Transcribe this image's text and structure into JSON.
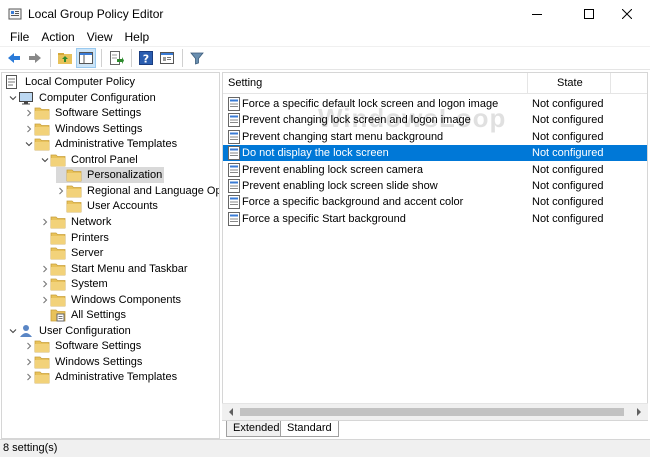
{
  "window": {
    "title": "Local Group Policy Editor",
    "minimize_icon": "minimize-icon",
    "maximize_icon": "maximize-icon",
    "close_icon": "close-icon"
  },
  "menu": [
    "File",
    "Action",
    "View",
    "Help"
  ],
  "toolbar": {
    "icons": [
      "back-arrow-icon",
      "forward-arrow-icon",
      "up-folder-icon",
      "show-hide-tree-icon",
      "export-list-icon",
      "help-icon",
      "properties-icon",
      "filter-icon"
    ]
  },
  "tree": [
    {
      "label": "Local Computer Policy",
      "level": 0,
      "arrow": "",
      "icon": "policy-icon"
    },
    {
      "label": "Computer Configuration",
      "level": 1,
      "arrow": "expanded",
      "icon": "computer-icon"
    },
    {
      "label": "Software Settings",
      "level": 2,
      "arrow": "collapsed",
      "icon": "folder-icon"
    },
    {
      "label": "Windows Settings",
      "level": 2,
      "arrow": "collapsed",
      "icon": "folder-icon"
    },
    {
      "label": "Administrative Templates",
      "level": 2,
      "arrow": "expanded",
      "icon": "folder-icon"
    },
    {
      "label": "Control Panel",
      "level": 3,
      "arrow": "expanded",
      "icon": "folder-icon"
    },
    {
      "label": "Personalization",
      "level": 4,
      "arrow": "",
      "icon": "folder-icon",
      "selected": true
    },
    {
      "label": "Regional and Language Opt",
      "level": 4,
      "arrow": "collapsed",
      "icon": "folder-icon"
    },
    {
      "label": "User Accounts",
      "level": 4,
      "arrow": "",
      "icon": "folder-icon"
    },
    {
      "label": "Network",
      "level": 3,
      "arrow": "collapsed",
      "icon": "folder-icon"
    },
    {
      "label": "Printers",
      "level": 3,
      "arrow": "",
      "icon": "folder-icon"
    },
    {
      "label": "Server",
      "level": 3,
      "arrow": "",
      "icon": "folder-icon"
    },
    {
      "label": "Start Menu and Taskbar",
      "level": 3,
      "arrow": "collapsed",
      "icon": "folder-icon"
    },
    {
      "label": "System",
      "level": 3,
      "arrow": "collapsed",
      "icon": "folder-icon"
    },
    {
      "label": "Windows Components",
      "level": 3,
      "arrow": "collapsed",
      "icon": "folder-icon"
    },
    {
      "label": "All Settings",
      "level": 3,
      "arrow": "",
      "icon": "all-settings-icon"
    },
    {
      "label": "User Configuration",
      "level": 1,
      "arrow": "expanded",
      "icon": "user-icon"
    },
    {
      "label": "Software Settings",
      "level": 2,
      "arrow": "collapsed",
      "icon": "folder-icon"
    },
    {
      "label": "Windows Settings",
      "level": 2,
      "arrow": "collapsed",
      "icon": "folder-icon"
    },
    {
      "label": "Administrative Templates",
      "level": 2,
      "arrow": "collapsed",
      "icon": "folder-icon"
    }
  ],
  "list": {
    "columns": {
      "setting": "Setting",
      "state": "State"
    },
    "rows": [
      {
        "setting": "Force a specific default lock screen and logon image",
        "state": "Not configured"
      },
      {
        "setting": "Prevent changing lock screen and logon image",
        "state": "Not configured"
      },
      {
        "setting": "Prevent changing start menu background",
        "state": "Not configured"
      },
      {
        "setting": "Do not display the lock screen",
        "state": "Not configured",
        "selected": true
      },
      {
        "setting": "Prevent enabling lock screen camera",
        "state": "Not configured"
      },
      {
        "setting": "Prevent enabling lock screen slide show",
        "state": "Not configured"
      },
      {
        "setting": "Force a specific background and accent color",
        "state": "Not configured"
      },
      {
        "setting": "Force a specific Start background",
        "state": "Not configured"
      }
    ],
    "watermark": "WindowsLoop"
  },
  "tabs": [
    {
      "label": "Extended",
      "active": false
    },
    {
      "label": "Standard",
      "active": true
    }
  ],
  "status": {
    "text": "8 setting(s)"
  },
  "colors": {
    "selection": "#0078d7",
    "tree_selection": "#d9d9d9",
    "folder": "#e8c25a"
  }
}
